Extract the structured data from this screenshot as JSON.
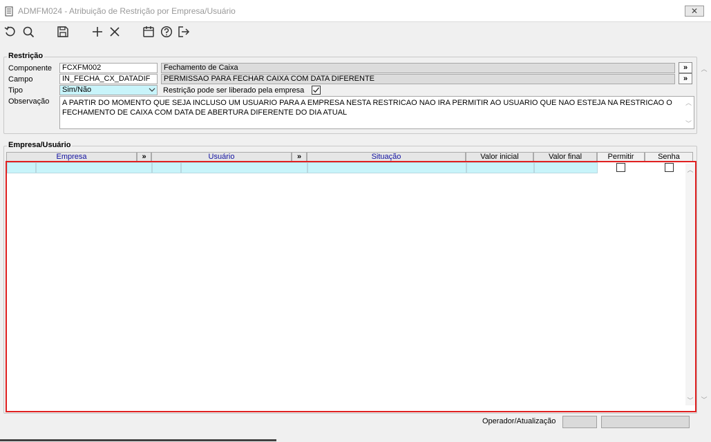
{
  "window": {
    "title": "ADMFM024 - Atribuição de Restrição por Empresa/Usuário",
    "close_label": "✕"
  },
  "toolbar": {
    "icons": [
      "undo-icon",
      "search-icon",
      "save-icon",
      "add-icon",
      "delete-icon",
      "calendar-icon",
      "help-icon",
      "exit-icon"
    ]
  },
  "restricao": {
    "legend": "Restrição",
    "componente_label": "Componente",
    "componente_value": "FCXFM002",
    "componente_desc": "Fechamento de Caixa",
    "campo_label": "Campo",
    "campo_value": "IN_FECHA_CX_DATADIF",
    "campo_desc": "PERMISSAO PARA FECHAR CAIXA COM DATA DIFERENTE",
    "tipo_label": "Tipo",
    "tipo_value": "Sim/Não",
    "liberado_label": "Restrição pode ser liberado pela empresa",
    "liberado_checked": true,
    "observacao_label": "Observação",
    "observacao_value": "A PARTIR DO MOMENTO QUE SEJA INCLUSO UM USUARIO PARA A EMPRESA NESTA RESTRICAO NAO IRA PERMITIR AO USUARIO QUE NAO ESTEJA NA RESTRICAO O FECHAMENTO DE CAIXA COM DATA DE ABERTURA DIFERENTE DO DIA ATUAL",
    "lookup_label": "»"
  },
  "empresa_usuario": {
    "legend": "Empresa/Usuário",
    "columns": {
      "empresa": "Empresa",
      "lookup1": "»",
      "usuario": "Usuário",
      "lookup2": "»",
      "situacao": "Situação",
      "valor_inicial": "Valor inicial",
      "valor_final": "Valor final",
      "permitir": "Permitir",
      "senha": "Senha"
    },
    "rows": [
      {
        "empresa_code": "",
        "empresa": "",
        "usuario_code": "",
        "usuario": "",
        "situacao": "",
        "valor_inicial": "",
        "valor_final": "",
        "permitir": false,
        "senha": false
      }
    ]
  },
  "status": {
    "operador_label": "Operador/Atualização",
    "operador_value": "",
    "atualizacao_value": ""
  },
  "colors": {
    "highlight": "#c8f4fa",
    "selection_border": "#e02020",
    "header_text": "#1010a0"
  }
}
